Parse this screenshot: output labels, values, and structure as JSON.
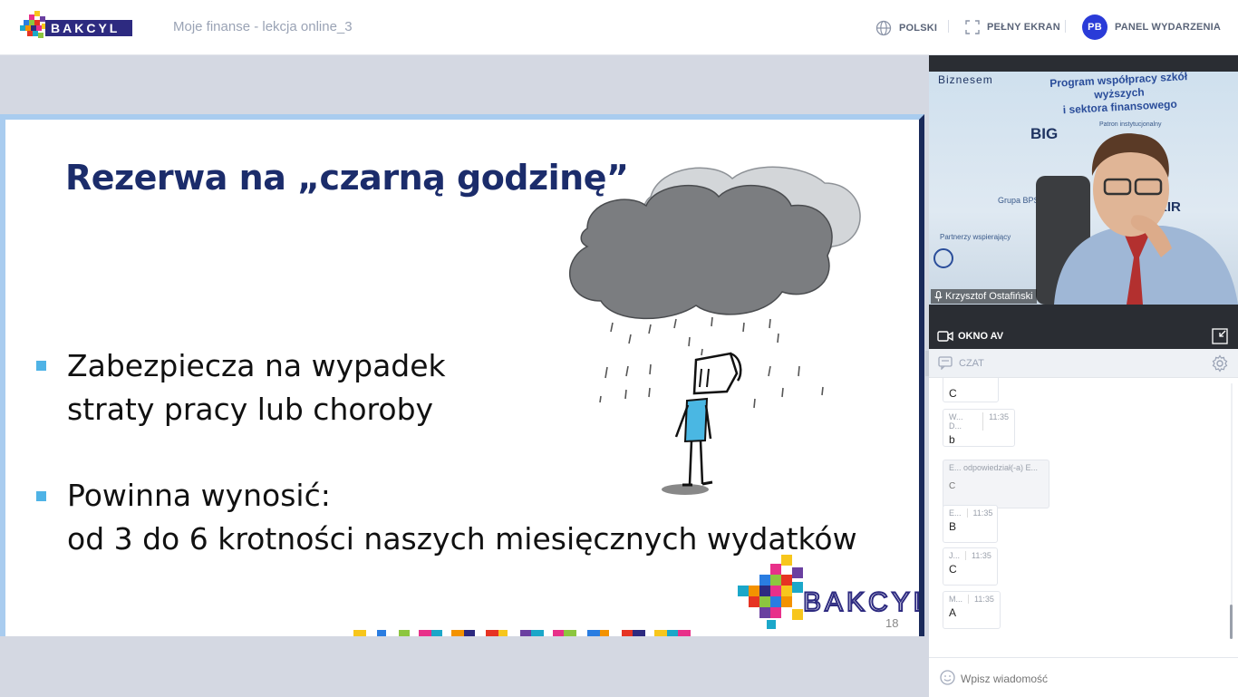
{
  "header": {
    "logo_text": "BAKCYL",
    "event_title": "Moje finanse - lekcja online_3",
    "language_label": "POLSKI",
    "fullscreen_label": "PEŁNY EKRAN",
    "avatar_initials": "PB",
    "event_panel_label": "PANEL WYDARZENIA"
  },
  "slide": {
    "title": "Rezerwa na „czarną godzinę”",
    "bullets": [
      {
        "line1": "Zabezpiecza na wypadek",
        "line2": "straty pracy lub choroby"
      },
      {
        "line1": "Powinna wynosić:",
        "line2": "od 3 do 6 krotności naszych miesięcznych wydatków"
      }
    ],
    "page_number": "18",
    "logo_text": "BAKCYL"
  },
  "video": {
    "participant_name": "Krzysztof Ostafiński",
    "banner_lines": [
      "Program współpracy szkół wyższych",
      "i sektora finansowego"
    ],
    "bg_text_biznesem": "Biznesem",
    "bg_text_big": "BIG",
    "bg_text_kir": "KIR",
    "bg_text_grupa": "Grupa BPS",
    "bg_text_partnerzy": "Partnerzy wspierający",
    "bg_text_patron": "Patron instytucjonalny"
  },
  "av_bar": {
    "label": "OKNO AV"
  },
  "chat": {
    "title": "CZAT",
    "input_placeholder": "Wpisz wiadomość",
    "messages": [
      {
        "author": "",
        "time": "",
        "text": "C"
      },
      {
        "author": "W... D...",
        "time": "11:35",
        "text": "b"
      },
      {
        "author": "E... odpowiedział(-a) E...",
        "time": "",
        "text": "C"
      },
      {
        "author": "E...",
        "time": "11:35",
        "text": "B"
      },
      {
        "author": "J...",
        "time": "11:35",
        "text": "C"
      },
      {
        "author": "M...",
        "time": "11:35",
        "text": "A"
      }
    ]
  },
  "colors": {
    "accent": "#2a3bd8",
    "slide_title": "#1b2c6b",
    "bullet": "#4fb3e6"
  }
}
